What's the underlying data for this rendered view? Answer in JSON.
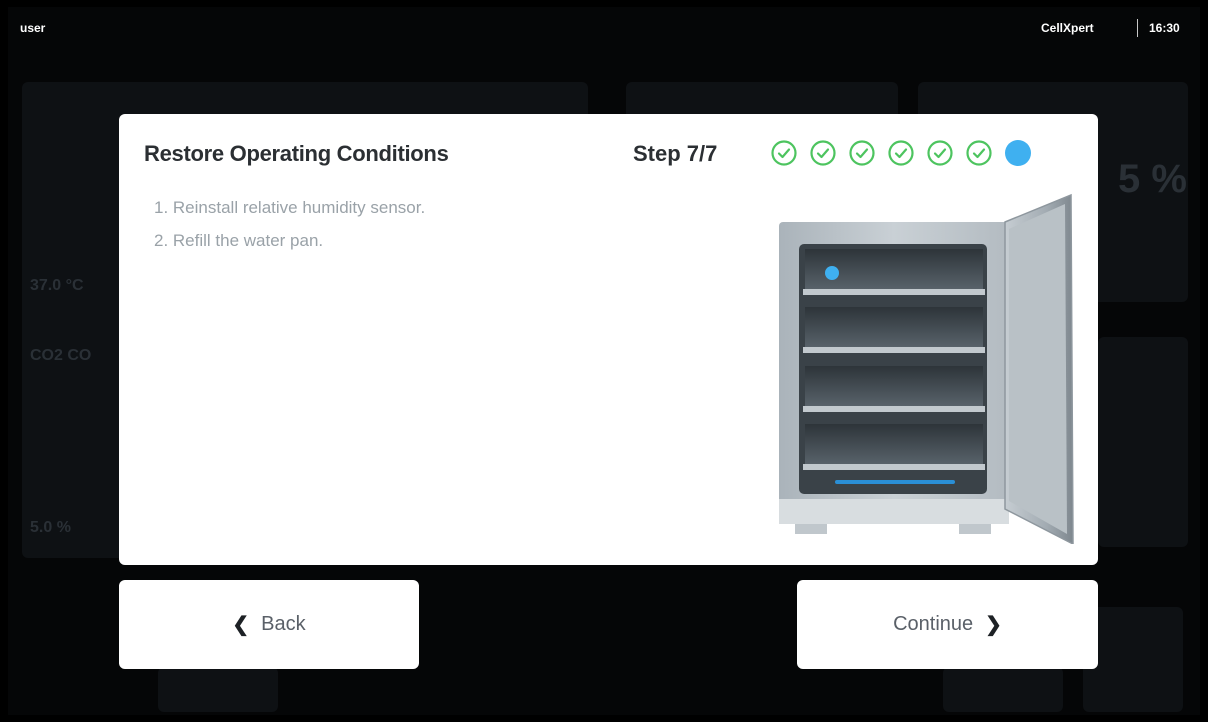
{
  "topbar": {
    "user": "user",
    "brand": "CellXpert",
    "time": "16:30"
  },
  "background": {
    "value_temp": "37.0 °C",
    "value_co2": "CO2 CO",
    "value_o2": "5.0 %",
    "value_hum": "5 %"
  },
  "dialog": {
    "title": "Restore Operating Conditions",
    "step_label": "Step 7/7",
    "steps_total": 7,
    "steps_completed": 6,
    "current_step": 7,
    "instructions": [
      "1. Reinstall relative humidity sensor.",
      "2. Refill the water pan."
    ],
    "illustration": "incubator-open-door-illustration"
  },
  "buttons": {
    "back": "Back",
    "continue": "Continue"
  },
  "colors": {
    "completed": "#4dc45f",
    "current": "#3fb0f0",
    "title": "#2b2f33",
    "instruction": "#9aa2a8"
  },
  "icons": [
    "check-circle-icon",
    "current-step-dot-icon",
    "chevron-left-icon",
    "chevron-right-icon"
  ]
}
